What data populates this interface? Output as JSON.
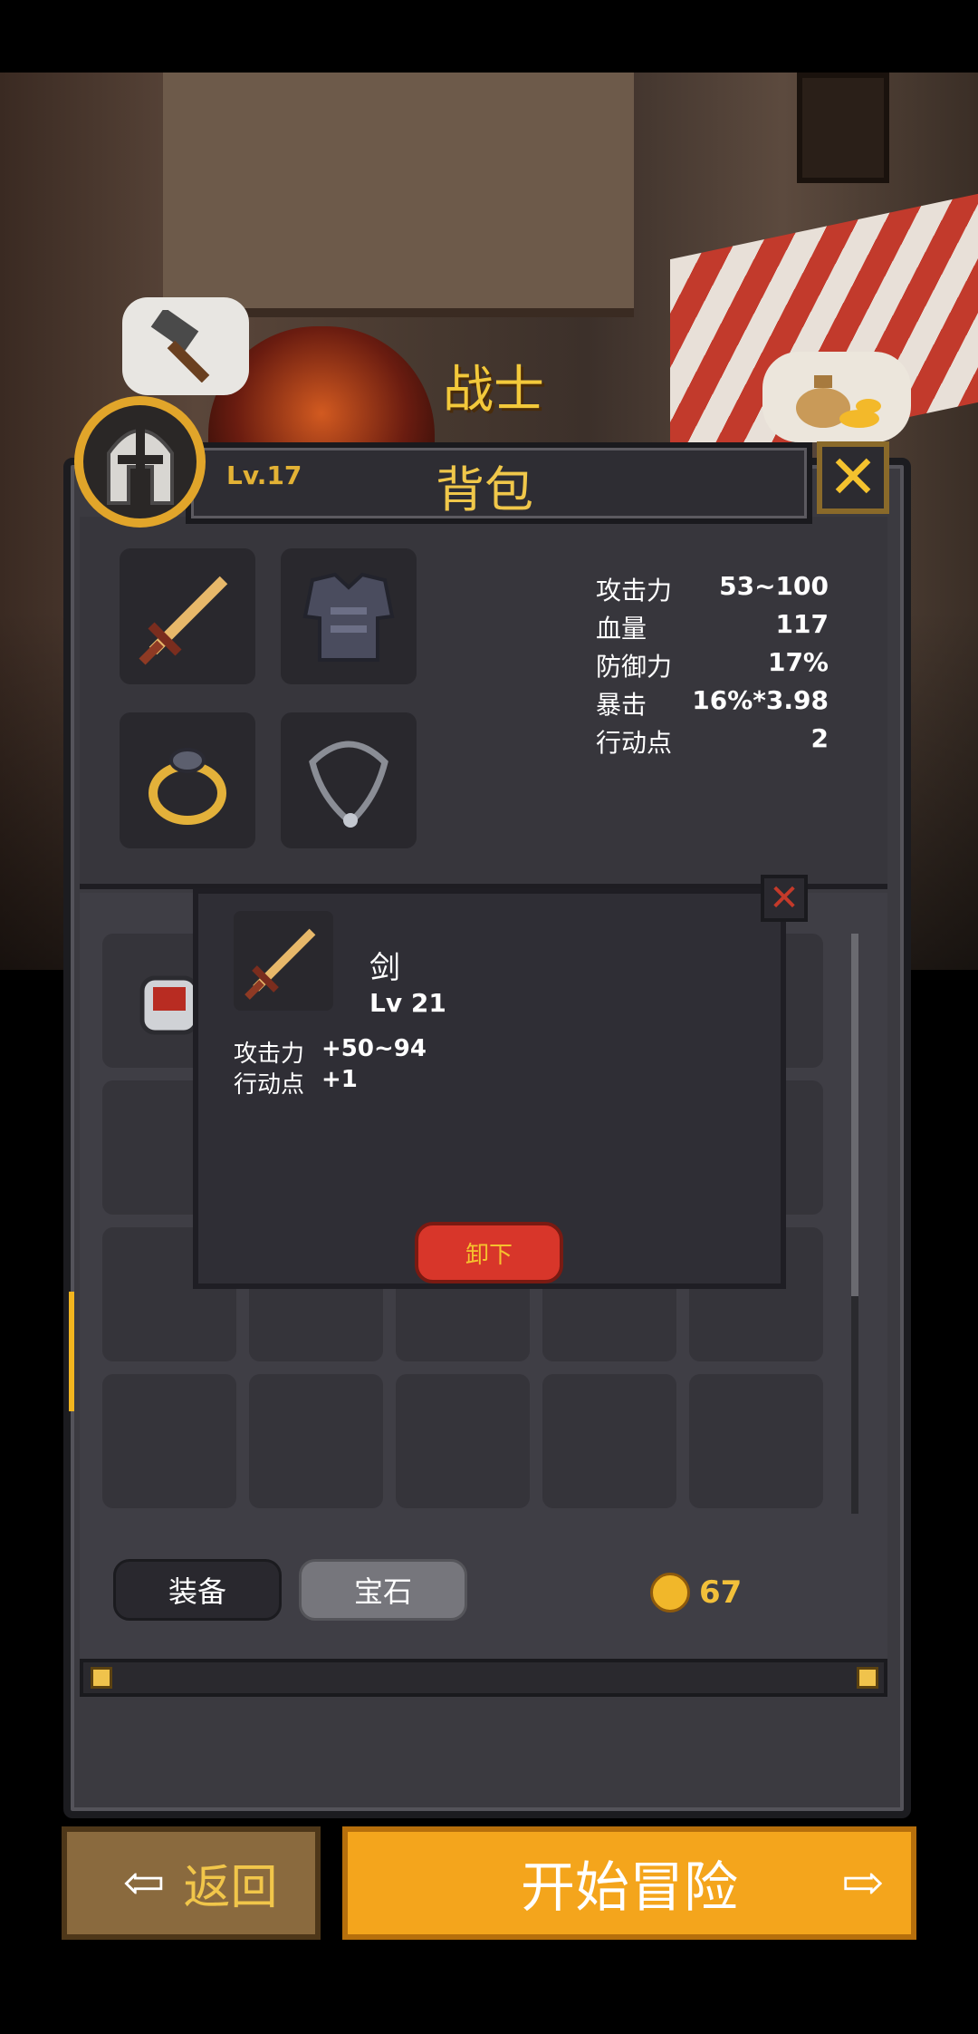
{
  "class_name": "战士",
  "header": {
    "level": "Lv.17",
    "title": "背包",
    "close_glyph": "✕"
  },
  "stats": [
    {
      "label": "攻击力",
      "value": "53~100"
    },
    {
      "label": "血量",
      "value": "117"
    },
    {
      "label": "防御力",
      "value": "17%"
    },
    {
      "label": "暴击",
      "value": "16%*3.98"
    },
    {
      "label": "行动点",
      "value": "2"
    }
  ],
  "equipment_icons": [
    "sword-icon",
    "armor-icon",
    "ring-icon",
    "necklace-icon"
  ],
  "tooltip": {
    "item_name": "剑",
    "item_level": "Lv 21",
    "attrs": [
      {
        "label": "攻击力",
        "value": "+50~94"
      },
      {
        "label": "行动点",
        "value": "+1"
      }
    ],
    "unequip_label": "卸下",
    "close_glyph": "✕"
  },
  "tabs": {
    "equipment": "装备",
    "gem": "宝石"
  },
  "gold": "67",
  "buttons": {
    "back": "返回",
    "start": "开始冒险"
  },
  "colors": {
    "accent_gold": "#f4a51c",
    "unequip_red": "#d8362a",
    "panel": "#3b3a40"
  }
}
